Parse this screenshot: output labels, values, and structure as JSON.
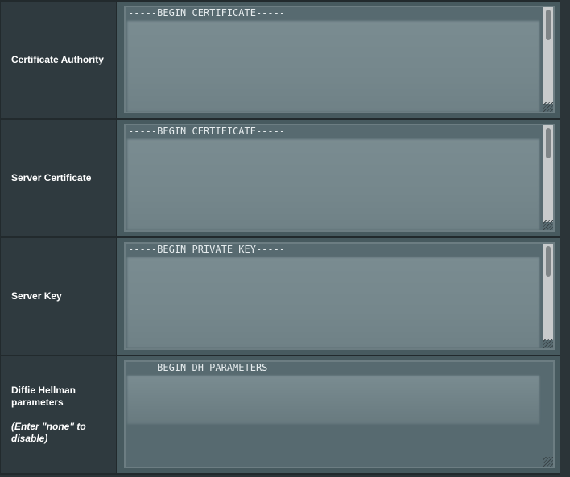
{
  "rows": [
    {
      "label": "Certificate Authority",
      "value_first_line": "-----BEGIN CERTIFICATE-----",
      "scrollbar": true
    },
    {
      "label": "Server Certificate",
      "value_first_line": "-----BEGIN CERTIFICATE-----",
      "scrollbar": true
    },
    {
      "label": "Server Key",
      "value_first_line": "-----BEGIN PRIVATE KEY-----",
      "scrollbar": true
    },
    {
      "label": "Diffie Hellman parameters",
      "hint": "(Enter \"none\" to disable)",
      "value_first_line": "-----BEGIN DH PARAMETERS-----",
      "scrollbar": false
    }
  ],
  "colors": {
    "label_bg": "#2f3a3f",
    "cell_bg": "#475a5f",
    "textarea_bg": "#576a70"
  }
}
